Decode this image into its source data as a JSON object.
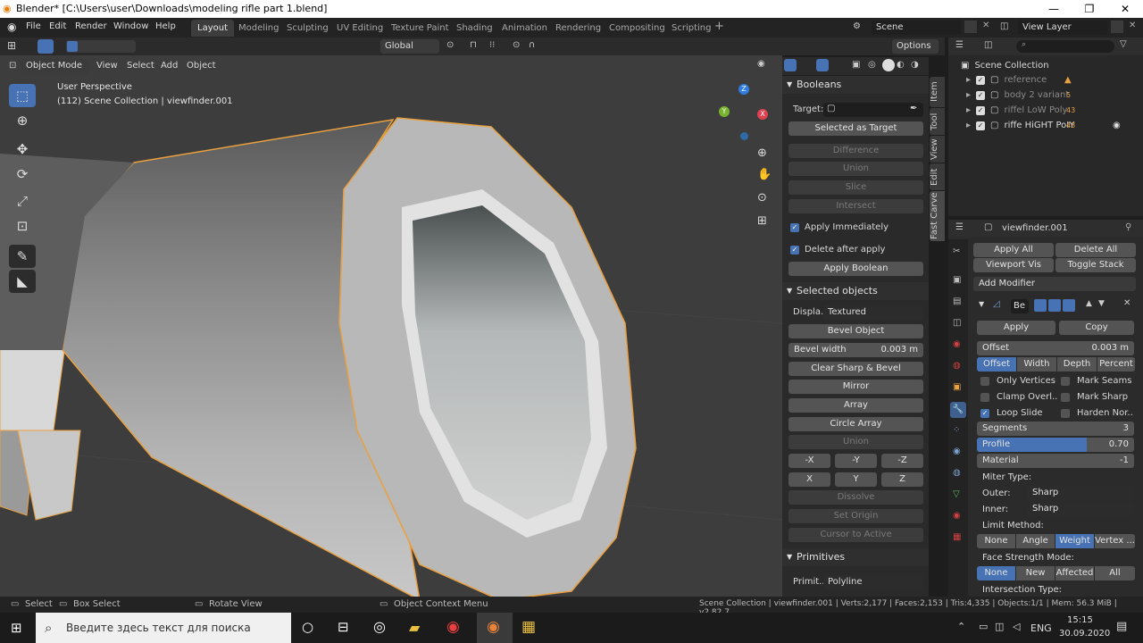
{
  "window": {
    "title": "Blender* [C:\\Users\\user\\Downloads\\modeling rifle part 1.blend]",
    "minimize": "—",
    "maximize": "❐",
    "close": "✕"
  },
  "menu": [
    "File",
    "Edit",
    "Render",
    "Window",
    "Help"
  ],
  "workspaces": [
    "Layout",
    "Modeling",
    "Sculpting",
    "UV Editing",
    "Texture Paint",
    "Shading",
    "Animation",
    "Rendering",
    "Compositing",
    "Scripting"
  ],
  "scene": "Scene",
  "view_layer": "View Layer",
  "header": {
    "transform": "Global",
    "options": "Options",
    "mode": "Object Mode",
    "view": "View",
    "select": "Select",
    "add": "Add",
    "object": "Object"
  },
  "viewport": {
    "perspective": "User Perspective",
    "context": "(112) Scene Collection | viewfinder.001"
  },
  "gizmo": {
    "x": "X",
    "y": "Y",
    "z": "Z"
  },
  "npanel": {
    "booleans_title": "Booleans",
    "target_label": "Target:",
    "selected_as_target": "Selected as Target",
    "difference": "Difference",
    "union": "Union",
    "slice": "Slice",
    "intersect": "Intersect",
    "apply_immediately": "Apply Immediately",
    "delete_after_apply": "Delete after apply",
    "apply_boolean": "Apply Boolean",
    "selected_title": "Selected objects",
    "display_label": "Displa..",
    "display_value": "Textured",
    "bevel_object": "Bevel Object",
    "bevel_width_label": "Bevel width",
    "bevel_width_value": "0.003 m",
    "clear_sharp": "Clear Sharp & Bevel",
    "mirror": "Mirror",
    "array": "Array",
    "circle_array": "Circle Array",
    "union2": "Union",
    "mx": "-X",
    "my": "-Y",
    "mz": "-Z",
    "px": "X",
    "py": "Y",
    "pz": "Z",
    "dissolve": "Dissolve",
    "set_origin": "Set Origin",
    "cursor_to_active": "Cursor to Active",
    "primitives_title": "Primitives",
    "primitive_label": "Primit..",
    "primitive_value": "Polyline",
    "tabs": [
      "Item",
      "Tool",
      "View",
      "Edit",
      "Fast Carve"
    ]
  },
  "outliner": {
    "root": "Scene Collection",
    "items": [
      {
        "name": "reference",
        "badge": ""
      },
      {
        "name": "body 2 variant",
        "badge": "5"
      },
      {
        "name": "riffel LoW Poly",
        "badge": "43"
      },
      {
        "name": "riffe HiGHT PoIY",
        "badge": "43"
      }
    ]
  },
  "props": {
    "object": "viewfinder.001",
    "apply_all": "Apply All",
    "delete_all": "Delete All",
    "viewport_vis": "Viewport Vis",
    "toggle_stack": "Toggle Stack",
    "add_modifier": "Add Modifier",
    "mod_name": "Be",
    "apply": "Apply",
    "copy": "Copy",
    "offset_label": "Offset",
    "offset_value": "0.003 m",
    "width_types": [
      "Offset",
      "Width",
      "Depth",
      "Percent"
    ],
    "only_vertices": "Only Vertices",
    "mark_seams": "Mark Seams",
    "clamp_overlap": "Clamp Overl..",
    "mark_sharp": "Mark Sharp",
    "loop_slide": "Loop Slide",
    "harden_normals": "Harden Nor..",
    "segments_label": "Segments",
    "segments_value": "3",
    "profile_label": "Profile",
    "profile_value": "0.70",
    "profile_fraction": 0.7,
    "material_label": "Material",
    "material_value": "-1",
    "miter_type": "Miter Type:",
    "outer_label": "Outer:",
    "outer_value": "Sharp",
    "inner_label": "Inner:",
    "inner_value": "Sharp",
    "limit_method": "Limit Method:",
    "limit_options": [
      "None",
      "Angle",
      "Weight",
      "Vertex ..."
    ],
    "face_strength": "Face Strength Mode:",
    "face_options": [
      "None",
      "New",
      "Affected",
      "All"
    ],
    "intersection_type": "Intersection Type:"
  },
  "status": {
    "select": "Select",
    "box_select": "Box Select",
    "rotate_view": "Rotate View",
    "context_menu": "Object Context Menu",
    "stats": "Scene Collection | viewfinder.001 | Verts:2,177 | Faces:2,153 | Tris:4,335 | Objects:1/1 | Mem: 56.3 MiB | v2.82.7"
  },
  "taskbar": {
    "search_placeholder": "Введите здесь текст для поиска",
    "lang": "ENG",
    "time": "15:15",
    "date": "30.09.2020"
  }
}
